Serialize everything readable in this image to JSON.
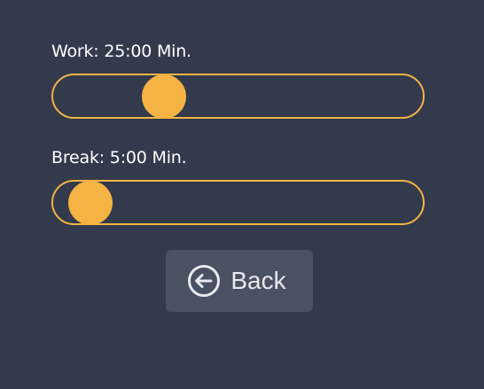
{
  "settings": {
    "work": {
      "label": "Work: 25:00 Min.",
      "slider_fraction": 0.3
    },
    "break": {
      "label": "Break: 5:00 Min.",
      "slider_fraction": 0.1
    }
  },
  "back_button": {
    "label": "Back",
    "icon": "arrow-left-circle-icon"
  },
  "colors": {
    "background": "#323a4c",
    "accent": "#f4b343",
    "button_bg": "#4a5162",
    "text": "#ffffff"
  }
}
